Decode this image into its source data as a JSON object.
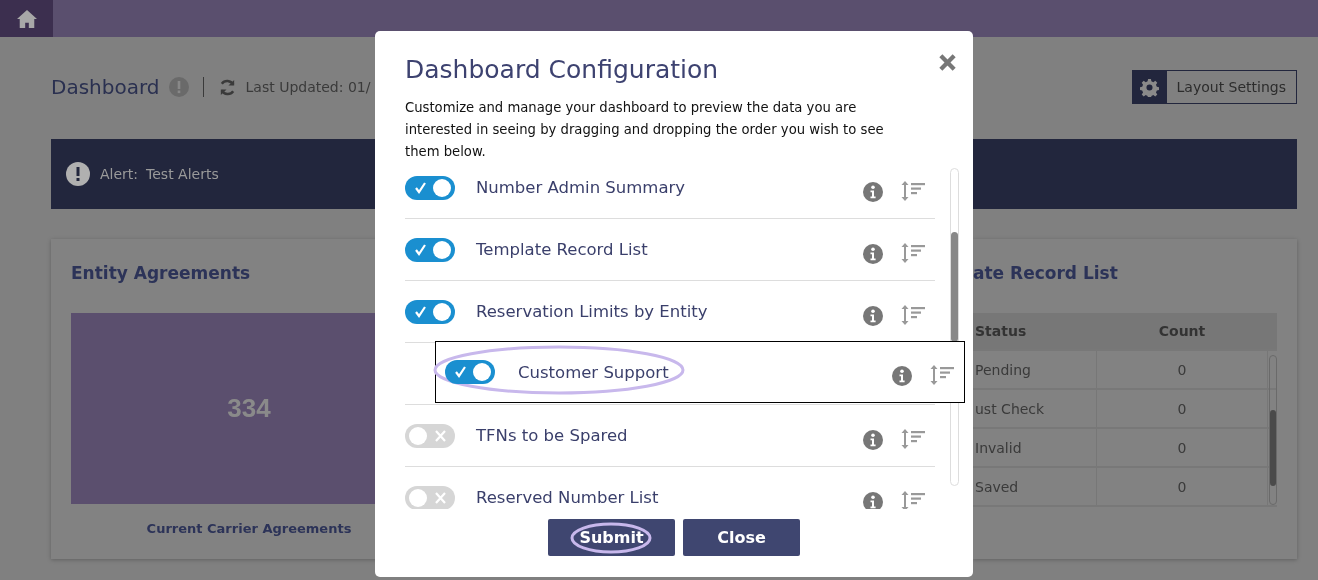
{
  "header": {
    "title": "Dashboard",
    "last_updated": "Last Updated: 01/",
    "layout_button": "Layout Settings"
  },
  "alert": {
    "label": "Alert:",
    "text": "Test Alerts"
  },
  "left_card": {
    "title": "Entity Agreements",
    "value": "334",
    "caption": "Current Carrier Agreements"
  },
  "right_card": {
    "title": "ate Record List",
    "columns": [
      "Status",
      "Count"
    ],
    "rows": [
      [
        "Pending",
        "0"
      ],
      [
        "ust Check",
        "0"
      ],
      [
        "Invalid",
        "0"
      ],
      [
        "Saved",
        "0"
      ]
    ]
  },
  "dialog": {
    "title": "Dashboard Configuration",
    "description": "Customize and manage your dashboard to preview the data you are interested in seeing by dragging and dropping the order you wish to see them below.",
    "items": [
      {
        "kind": "item",
        "label": "Number Admin Summary",
        "on": true
      },
      {
        "kind": "item",
        "label": "Template Record List",
        "on": true
      },
      {
        "kind": "item",
        "label": "Reservation Limits by Entity",
        "on": true
      },
      {
        "kind": "placeholder"
      },
      {
        "kind": "item",
        "label": "TFNs to be Spared",
        "on": false
      },
      {
        "kind": "item",
        "label": "Reserved Number List",
        "on": false
      }
    ],
    "dragged": {
      "label": "Customer Support",
      "on": true
    },
    "buttons": [
      "Submit",
      "Close"
    ]
  }
}
